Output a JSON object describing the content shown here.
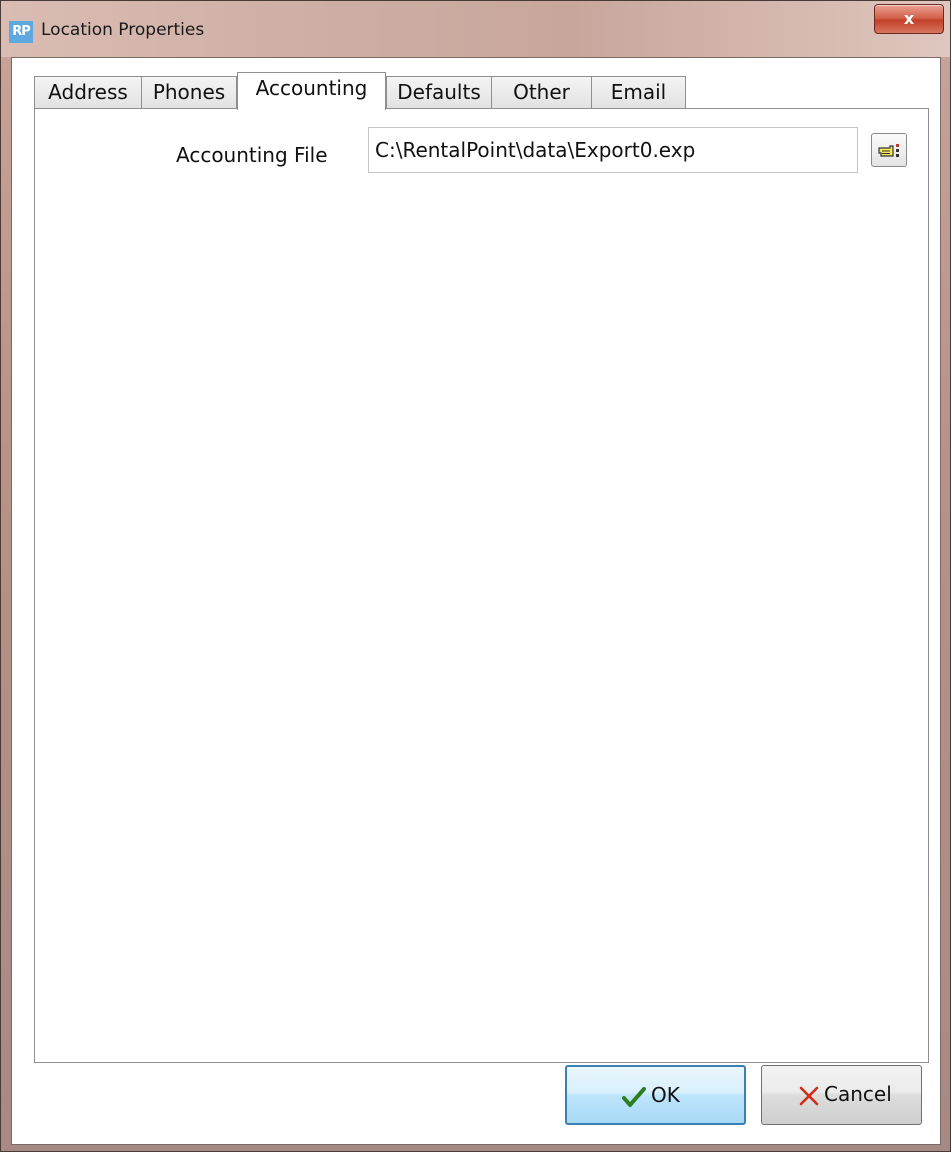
{
  "window": {
    "app_icon_text": "RP",
    "title": "Location Properties",
    "close_glyph": "x"
  },
  "tabs": [
    {
      "label": "Address",
      "active": false
    },
    {
      "label": "Phones",
      "active": false
    },
    {
      "label": "Accounting",
      "active": true
    },
    {
      "label": "Defaults",
      "active": false
    },
    {
      "label": "Other",
      "active": false
    },
    {
      "label": "Email",
      "active": false
    }
  ],
  "accounting": {
    "file_label": "Accounting File",
    "file_value": "C:\\RentalPoint\\data\\Export0.exp",
    "browse_icon": "pointing-hand-icon"
  },
  "buttons": {
    "ok": {
      "label": "OK",
      "icon": "checkmark-icon",
      "icon_color": "#2e7d1e"
    },
    "cancel": {
      "label": "Cancel",
      "icon": "x-icon",
      "icon_color": "#d42a1a"
    }
  },
  "colors": {
    "titlebar": "#cfb0a6",
    "close": "#c2402a",
    "default_button_border": "#3c7fb1"
  }
}
